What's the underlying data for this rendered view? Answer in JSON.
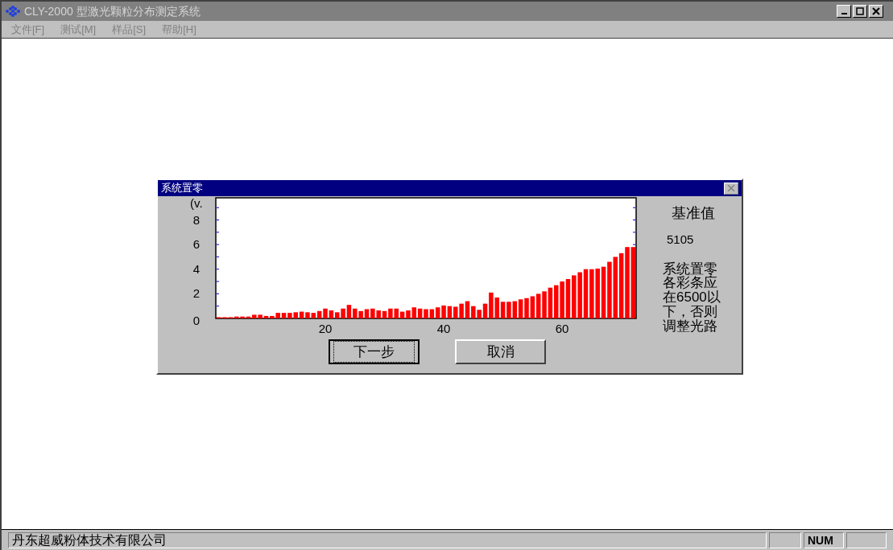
{
  "window": {
    "title": "CLY-2000 型激光颗粒分布测定系统"
  },
  "menu": [
    {
      "label": "文件[F]"
    },
    {
      "label": "测试[M]"
    },
    {
      "label": "样品[S]"
    },
    {
      "label": "帮助[H]"
    }
  ],
  "dialog": {
    "title": "系统置零",
    "chart_data": {
      "type": "bar",
      "ylabel": "(v.",
      "xlim": [
        1.5,
        72.5
      ],
      "ylim": [
        0,
        9.8
      ],
      "xticks": [
        20,
        40,
        60
      ],
      "yticks": [
        0,
        2,
        4,
        6,
        8
      ],
      "x": [
        2,
        3,
        4,
        5,
        6,
        7,
        8,
        9,
        10,
        11,
        12,
        13,
        14,
        15,
        16,
        17,
        18,
        19,
        20,
        21,
        22,
        23,
        24,
        25,
        26,
        27,
        28,
        29,
        30,
        31,
        32,
        33,
        34,
        35,
        36,
        37,
        38,
        39,
        40,
        41,
        42,
        43,
        44,
        45,
        46,
        47,
        48,
        49,
        50,
        51,
        52,
        53,
        54,
        55,
        56,
        57,
        58,
        59,
        60,
        61,
        62,
        63,
        64,
        65,
        66,
        67,
        68,
        69,
        70,
        71,
        72
      ],
      "series": [
        {
          "color": "#ff0000",
          "values": [
            0.1,
            0.1,
            0.1,
            0.15,
            0.15,
            0.15,
            0.3,
            0.3,
            0.2,
            0.2,
            0.45,
            0.45,
            0.45,
            0.5,
            0.55,
            0.5,
            0.45,
            0.6,
            0.8,
            0.65,
            0.5,
            0.8,
            1.1,
            0.8,
            0.6,
            0.75,
            0.8,
            0.65,
            0.6,
            0.8,
            0.8,
            0.55,
            0.65,
            0.9,
            0.8,
            0.75,
            0.75,
            0.9,
            1.05,
            1.0,
            0.95,
            1.2,
            1.4,
            1.0,
            0.7,
            1.2,
            2.1,
            1.7,
            1.35,
            1.35,
            1.4,
            1.55,
            1.65,
            1.8,
            2.0,
            2.2,
            2.5,
            2.7,
            3.0,
            3.2,
            3.5,
            3.75,
            4.0,
            4.0,
            4.05,
            4.2,
            4.6,
            5.0,
            5.3,
            5.8,
            5.8
          ]
        }
      ]
    },
    "reference_label": "基准值",
    "reference_value": "5105",
    "note": "系统置零各彩条应在6500以下，否则调整光路",
    "buttons": [
      {
        "label": "下一步",
        "default": true
      },
      {
        "label": "取消",
        "default": false
      }
    ]
  },
  "status_bar": {
    "company": "丹东超威粉体技术有限公司",
    "num": "NUM"
  }
}
